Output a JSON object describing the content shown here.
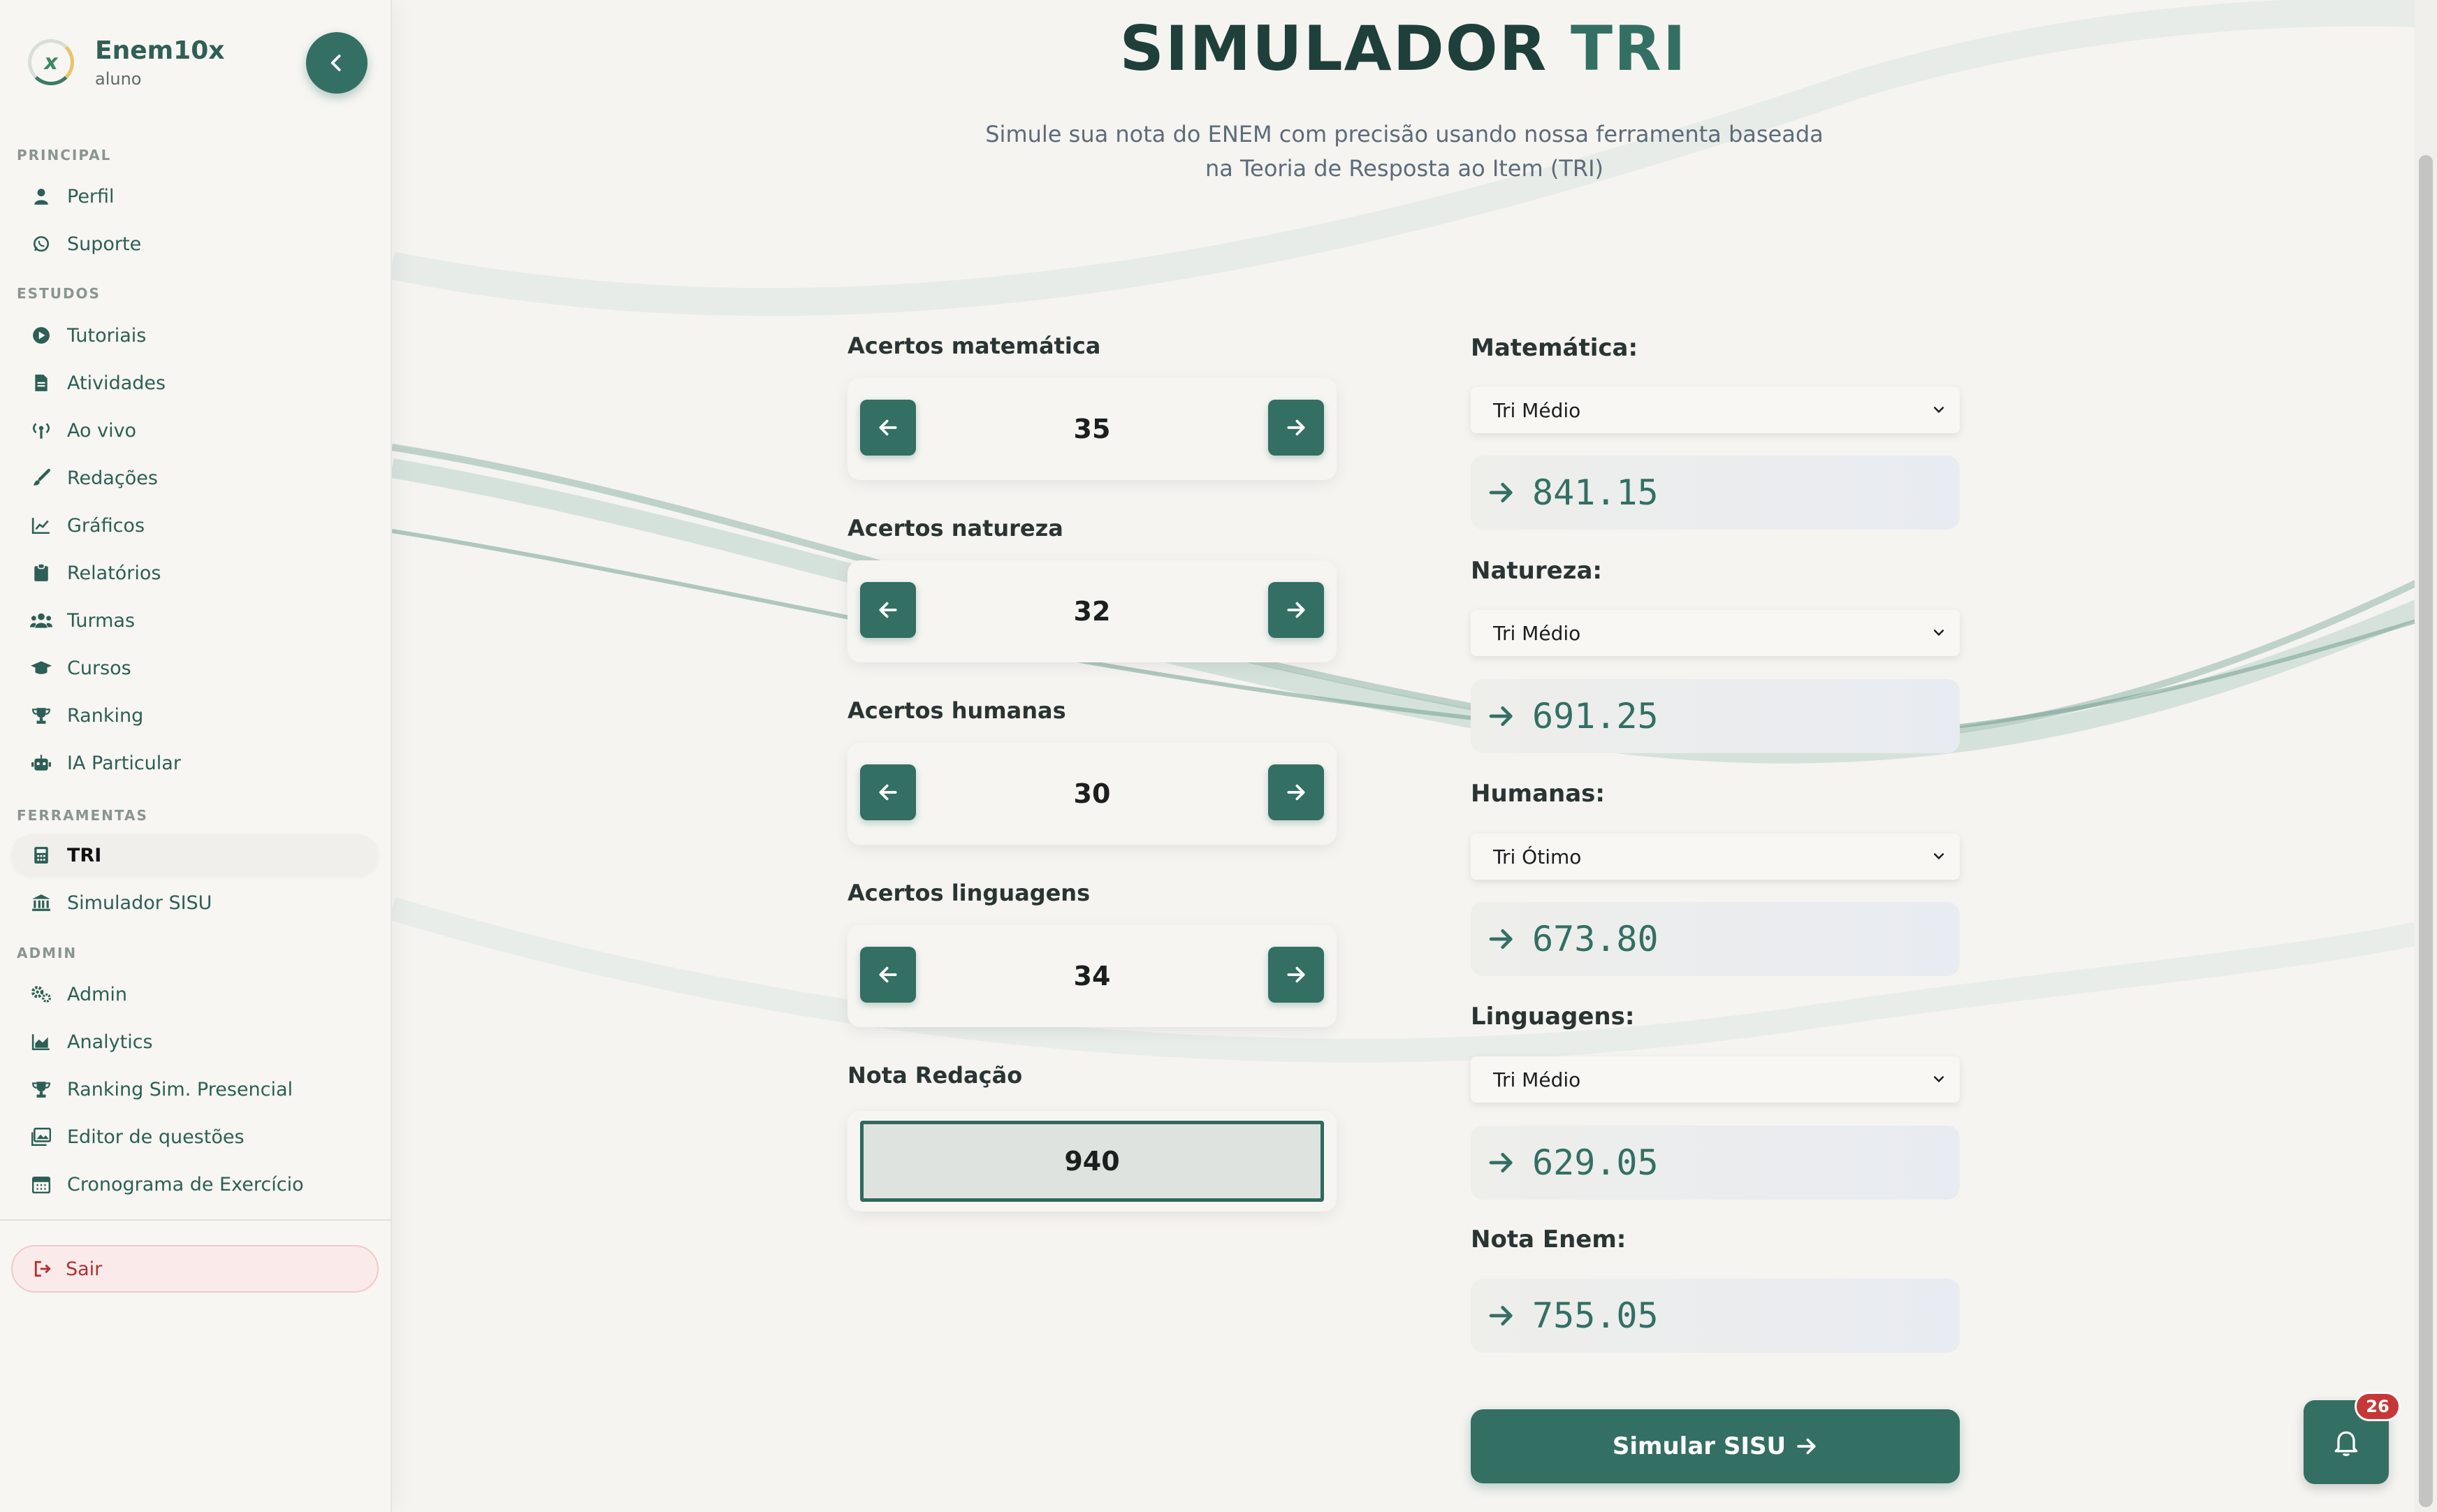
{
  "brand": {
    "title": "Enem10x",
    "role": "aluno",
    "logo_letter": "x"
  },
  "sidebar": {
    "sections": {
      "principal": "PRINCIPAL",
      "estudos": "ESTUDOS",
      "ferramentas": "FERRAMENTAS",
      "admin": "ADMIN"
    },
    "items": [
      {
        "label": "Perfil",
        "icon": "user-icon"
      },
      {
        "label": "Suporte",
        "icon": "whatsapp-icon"
      },
      {
        "label": "Tutoriais",
        "icon": "play-circle-icon"
      },
      {
        "label": "Atividades",
        "icon": "file-icon"
      },
      {
        "label": "Ao vivo",
        "icon": "broadcast-icon"
      },
      {
        "label": "Redações",
        "icon": "brush-icon"
      },
      {
        "label": "Gráficos",
        "icon": "line-chart-icon"
      },
      {
        "label": "Relatórios",
        "icon": "clipboard-icon"
      },
      {
        "label": "Turmas",
        "icon": "users-icon"
      },
      {
        "label": "Cursos",
        "icon": "graduation-cap-icon"
      },
      {
        "label": "Ranking",
        "icon": "trophy-icon"
      },
      {
        "label": "IA Particular",
        "icon": "robot-icon"
      },
      {
        "label": "TRI",
        "icon": "calculator-icon",
        "active": true
      },
      {
        "label": "Simulador SISU",
        "icon": "bank-icon"
      },
      {
        "label": "Admin",
        "icon": "gears-icon"
      },
      {
        "label": "Analytics",
        "icon": "area-chart-icon"
      },
      {
        "label": "Ranking Sim. Presencial",
        "icon": "trophy-icon"
      },
      {
        "label": "Editor de questões",
        "icon": "images-icon"
      },
      {
        "label": "Cronograma de Exercício",
        "icon": "calendar-icon"
      }
    ],
    "logout": "Sair"
  },
  "page": {
    "title_part1": "SIMULADOR",
    "title_part2": "TRI",
    "subtitle": "Simule sua nota do ENEM com precisão usando nossa ferramenta baseada na Teoria de Resposta ao Item (TRI)"
  },
  "acertos": [
    {
      "label": "Acertos matemática",
      "value": "35"
    },
    {
      "label": "Acertos natureza",
      "value": "32"
    },
    {
      "label": "Acertos humanas",
      "value": "30"
    },
    {
      "label": "Acertos linguagens",
      "value": "34"
    }
  ],
  "redacao": {
    "label": "Nota Redação",
    "value": "940"
  },
  "results": [
    {
      "label": "Matemática:",
      "select": "Tri Médio",
      "score": "841.15"
    },
    {
      "label": "Natureza:",
      "select": "Tri Médio",
      "score": "691.25"
    },
    {
      "label": "Humanas:",
      "select": "Tri Ótimo",
      "score": "673.80"
    },
    {
      "label": "Linguagens:",
      "select": "Tri Médio",
      "score": "629.05"
    }
  ],
  "nota_enem": {
    "label": "Nota Enem:",
    "score": "755.05"
  },
  "sisu_button": "Simular SISU",
  "notifications": {
    "count": "26"
  },
  "colors": {
    "primary": "#336f63",
    "badge": "#c83737",
    "background": "#f5f4f1"
  }
}
